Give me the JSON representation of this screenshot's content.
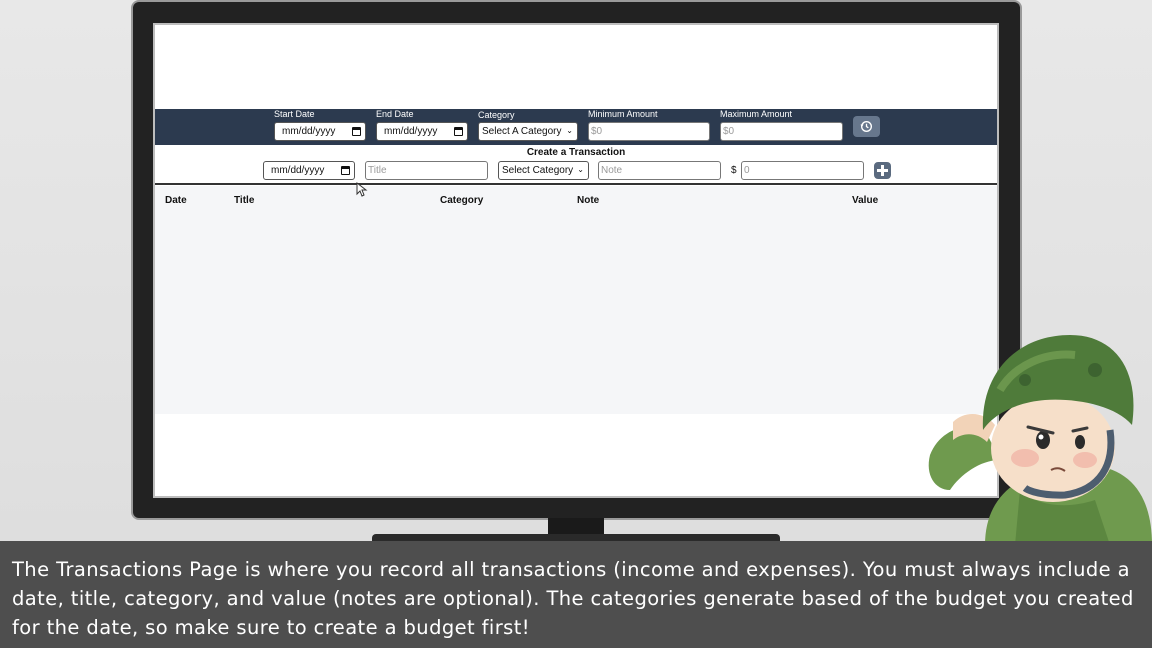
{
  "filters": {
    "start_date_label": "Start Date",
    "start_date_value": "mm/dd/yyyy",
    "end_date_label": "End Date",
    "end_date_value": "mm/dd/yyyy",
    "category_label": "Category",
    "category_value": "Select A Category",
    "min_amount_label": "Minimum Amount",
    "min_amount_placeholder": "$0",
    "max_amount_label": "Maximum Amount",
    "max_amount_placeholder": "$0",
    "reset_icon": "history-icon"
  },
  "create": {
    "title": "Create a Transaction",
    "date_value": "mm/dd/yyyy",
    "title_placeholder": "Title",
    "category_value": "Select Category",
    "note_placeholder": "Note",
    "currency_symbol": "$",
    "value_placeholder": "0",
    "add_icon": "plus-icon"
  },
  "table": {
    "columns": [
      "Date",
      "Title",
      "Category",
      "Note",
      "Value"
    ]
  },
  "caption": {
    "text": "The Transactions Page is where you record all transactions (income and expenses). You must always include a date, title, category, and value (notes are optional). The categories generate based of the budget you created for the date, so make sure to create a budget first!"
  },
  "colors": {
    "filter_bar": "#2c3a4f",
    "caption_bg": "#4e4e4e",
    "button": "#67778d"
  }
}
